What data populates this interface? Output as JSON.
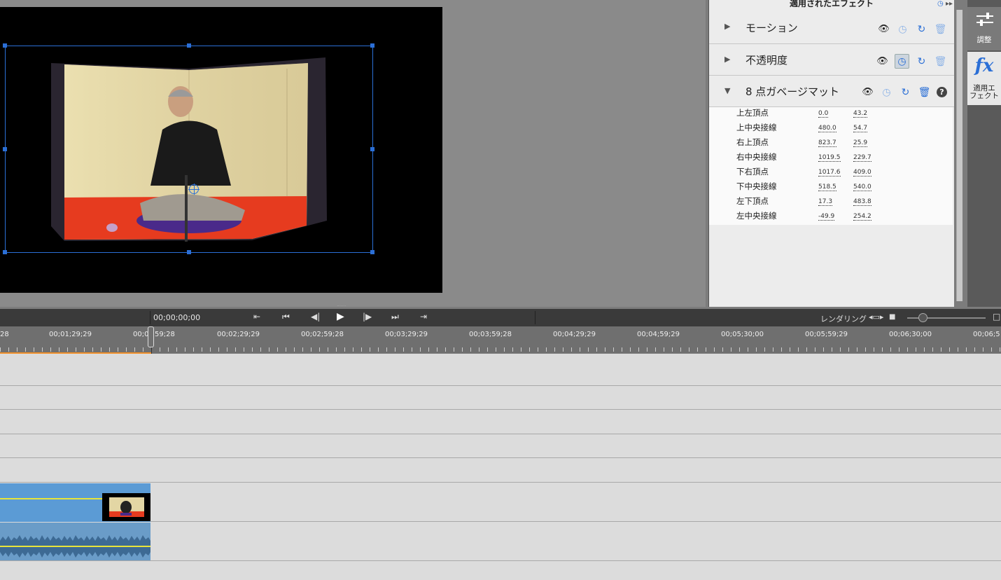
{
  "panel": {
    "title": "適用されたエフェクト",
    "effects": [
      {
        "name": "モーション",
        "expanded": false
      },
      {
        "name": "不透明度",
        "expanded": false
      },
      {
        "name": "8 点ガベージマット",
        "expanded": true
      }
    ],
    "params": [
      {
        "label": "上左頂点",
        "v1": "0.0",
        "v2": "43.2"
      },
      {
        "label": "上中央接線",
        "v1": "480.0",
        "v2": "54.7"
      },
      {
        "label": "右上頂点",
        "v1": "823.7",
        "v2": "25.9"
      },
      {
        "label": "右中央接線",
        "v1": "1019.5",
        "v2": "229.7"
      },
      {
        "label": "下右頂点",
        "v1": "1017.6",
        "v2": "409.0"
      },
      {
        "label": "下中央接線",
        "v1": "518.5",
        "v2": "540.0"
      },
      {
        "label": "左下頂点",
        "v1": "17.3",
        "v2": "483.8"
      },
      {
        "label": "左中央接線",
        "v1": "-49.9",
        "v2": "254.2"
      }
    ]
  },
  "tools": {
    "adjust_label": "調整",
    "fx_glyph": "fx",
    "fx_label_1": "適用エ",
    "fx_label_2": "フェクト"
  },
  "transport": {
    "timecode": "00;00;00;00",
    "render_label": "レンダリング"
  },
  "ruler": {
    "labels": [
      "28",
      "00;01;29;29",
      "00;0",
      "59;28",
      "00;02;29;29",
      "00;02;59;28",
      "00;03;29;29",
      "00;03;59;28",
      "00;04;29;29",
      "00;04;59;29",
      "00;05;30;00",
      "00;05;59;29",
      "00;06;30;00",
      "00;06;5"
    ]
  },
  "colors": {
    "accent": "#2b6fd6",
    "clip_video": "#5b9bd5",
    "clip_audio": "#6a9cc8",
    "volume_line": "#e8e43a",
    "played_range": "#f0902a"
  }
}
